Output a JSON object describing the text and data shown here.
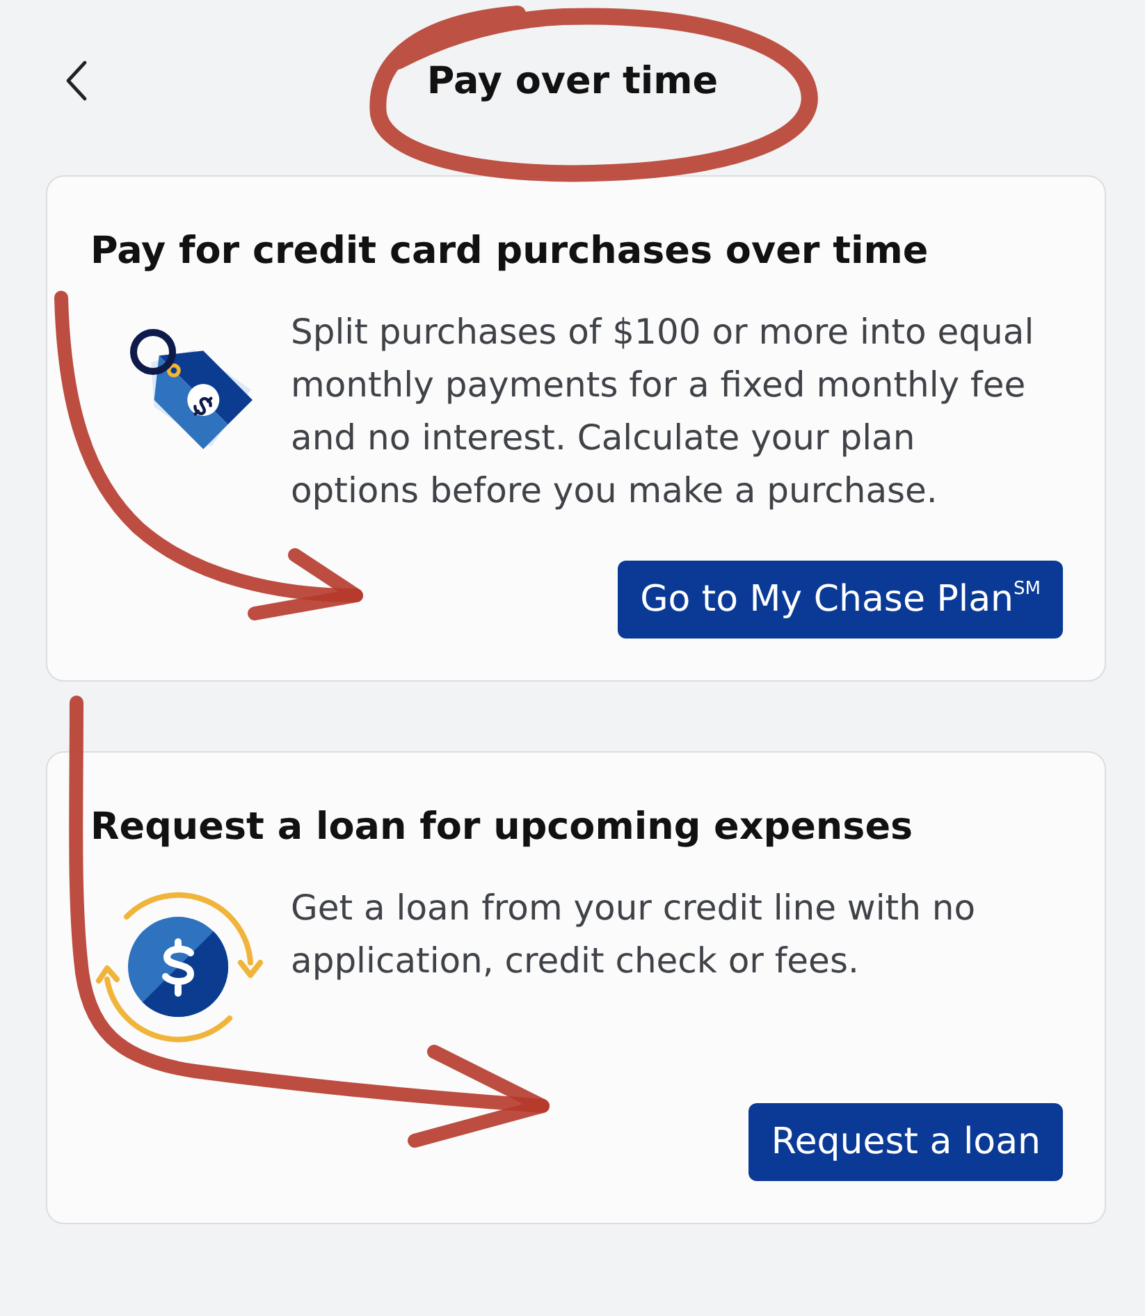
{
  "header": {
    "title": "Pay over time"
  },
  "cards": [
    {
      "kind": "tag",
      "title": "Pay for credit card purchases over time",
      "body": "Split purchases of $100 or more into equal monthly payments for a fixed monthly fee and no interest. Calculate your plan options before you make a purchase.",
      "button": "Go to My Chase Plan$^{SM}$"
    },
    {
      "kind": "loan",
      "title": "Request a loan for upcoming expenses",
      "body": "Get a loan from your credit line with no application, credit check or fees.",
      "button": "Request a loan"
    }
  ]
}
